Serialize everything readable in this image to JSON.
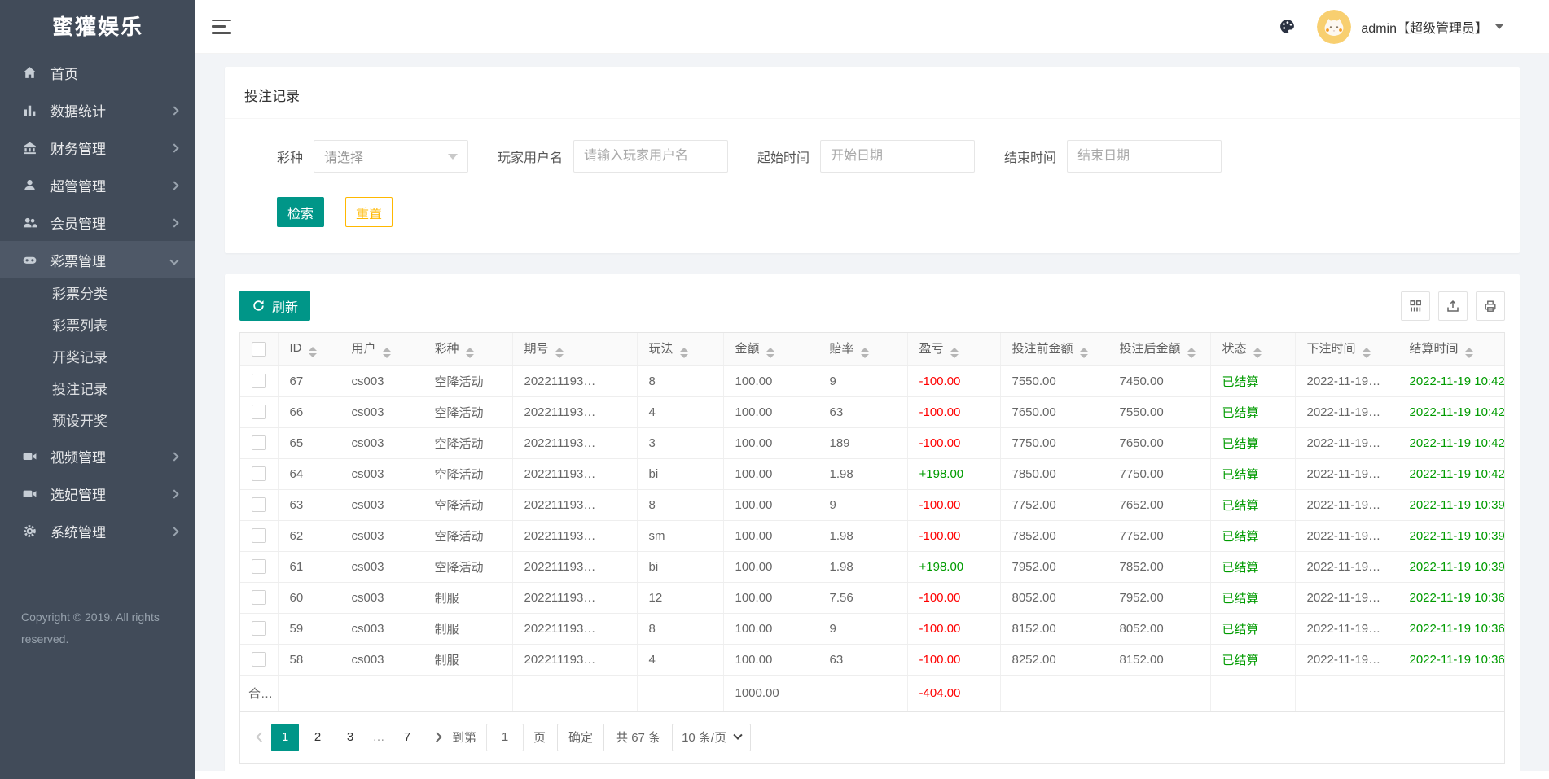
{
  "brand": {
    "logo": "蜜獾娱乐"
  },
  "colors": {
    "accent_green": "#009688",
    "warn_yellow": "#FFB800",
    "loss_red": "#ff0000",
    "win_green": "#009b00",
    "sidebar_bg": "#414b59"
  },
  "sidebar": {
    "items": [
      {
        "label": "首页",
        "icon": "home-icon"
      },
      {
        "label": "数据统计",
        "icon": "chart-icon"
      },
      {
        "label": "财务管理",
        "icon": "bank-icon"
      },
      {
        "label": "超管管理",
        "icon": "user-icon"
      },
      {
        "label": "会员管理",
        "icon": "users-icon"
      },
      {
        "label": "彩票管理",
        "icon": "gamepad-icon",
        "active": true,
        "children": [
          "彩票分类",
          "彩票列表",
          "开奖记录",
          "投注记录",
          "预设开奖"
        ]
      },
      {
        "label": "视频管理",
        "icon": "video-icon"
      },
      {
        "label": "选妃管理",
        "icon": "video-icon"
      },
      {
        "label": "系统管理",
        "icon": "gear-icon"
      }
    ],
    "copyright": "Copyright © 2019. All rights reserved."
  },
  "topbar": {
    "user": "admin【超级管理员】"
  },
  "page": {
    "title": "投注记录"
  },
  "filters": {
    "lottery_label": "彩种",
    "lottery_placeholder": "请选择",
    "username_label": "玩家用户名",
    "username_placeholder": "请输入玩家用户名",
    "start_label": "起始时间",
    "start_placeholder": "开始日期",
    "end_label": "结束时间",
    "end_placeholder": "结束日期",
    "search_button": "检索",
    "reset_button": "重置"
  },
  "table": {
    "refresh_button": "刷新",
    "columns": [
      {
        "key": "id",
        "label": "ID"
      },
      {
        "key": "user",
        "label": "用户"
      },
      {
        "key": "lottery",
        "label": "彩种"
      },
      {
        "key": "issue",
        "label": "期号"
      },
      {
        "key": "play",
        "label": "玩法"
      },
      {
        "key": "amount",
        "label": "金额"
      },
      {
        "key": "odds",
        "label": "赔率"
      },
      {
        "key": "profit",
        "label": "盈亏"
      },
      {
        "key": "before",
        "label": "投注前金额"
      },
      {
        "key": "after",
        "label": "投注后金额"
      },
      {
        "key": "status",
        "label": "状态"
      },
      {
        "key": "bet_time",
        "label": "下注时间"
      },
      {
        "key": "settle_time",
        "label": "结算时间"
      }
    ],
    "rows": [
      {
        "id": "67",
        "user": "cs003",
        "lottery": "空降活动",
        "issue": "202211193…",
        "play": "8",
        "amount": "100.00",
        "odds": "9",
        "profit": "-100.00",
        "before": "7550.00",
        "after": "7450.00",
        "status": "已结算",
        "bet_time": "2022-11-19…",
        "settle_time": "2022-11-19 10:42"
      },
      {
        "id": "66",
        "user": "cs003",
        "lottery": "空降活动",
        "issue": "202211193…",
        "play": "4",
        "amount": "100.00",
        "odds": "63",
        "profit": "-100.00",
        "before": "7650.00",
        "after": "7550.00",
        "status": "已结算",
        "bet_time": "2022-11-19…",
        "settle_time": "2022-11-19 10:42"
      },
      {
        "id": "65",
        "user": "cs003",
        "lottery": "空降活动",
        "issue": "202211193…",
        "play": "3",
        "amount": "100.00",
        "odds": "189",
        "profit": "-100.00",
        "before": "7750.00",
        "after": "7650.00",
        "status": "已结算",
        "bet_time": "2022-11-19…",
        "settle_time": "2022-11-19 10:42"
      },
      {
        "id": "64",
        "user": "cs003",
        "lottery": "空降活动",
        "issue": "202211193…",
        "play": "bi",
        "amount": "100.00",
        "odds": "1.98",
        "profit": "+198.00",
        "before": "7850.00",
        "after": "7750.00",
        "status": "已结算",
        "bet_time": "2022-11-19…",
        "settle_time": "2022-11-19 10:42"
      },
      {
        "id": "63",
        "user": "cs003",
        "lottery": "空降活动",
        "issue": "202211193…",
        "play": "8",
        "amount": "100.00",
        "odds": "9",
        "profit": "-100.00",
        "before": "7752.00",
        "after": "7652.00",
        "status": "已结算",
        "bet_time": "2022-11-19…",
        "settle_time": "2022-11-19 10:39"
      },
      {
        "id": "62",
        "user": "cs003",
        "lottery": "空降活动",
        "issue": "202211193…",
        "play": "sm",
        "amount": "100.00",
        "odds": "1.98",
        "profit": "-100.00",
        "before": "7852.00",
        "after": "7752.00",
        "status": "已结算",
        "bet_time": "2022-11-19…",
        "settle_time": "2022-11-19 10:39"
      },
      {
        "id": "61",
        "user": "cs003",
        "lottery": "空降活动",
        "issue": "202211193…",
        "play": "bi",
        "amount": "100.00",
        "odds": "1.98",
        "profit": "+198.00",
        "before": "7952.00",
        "after": "7852.00",
        "status": "已结算",
        "bet_time": "2022-11-19…",
        "settle_time": "2022-11-19 10:39"
      },
      {
        "id": "60",
        "user": "cs003",
        "lottery": "制服",
        "issue": "202211193…",
        "play": "12",
        "amount": "100.00",
        "odds": "7.56",
        "profit": "-100.00",
        "before": "8052.00",
        "after": "7952.00",
        "status": "已结算",
        "bet_time": "2022-11-19…",
        "settle_time": "2022-11-19 10:36"
      },
      {
        "id": "59",
        "user": "cs003",
        "lottery": "制服",
        "issue": "202211193…",
        "play": "8",
        "amount": "100.00",
        "odds": "9",
        "profit": "-100.00",
        "before": "8152.00",
        "after": "8052.00",
        "status": "已结算",
        "bet_time": "2022-11-19…",
        "settle_time": "2022-11-19 10:36"
      },
      {
        "id": "58",
        "user": "cs003",
        "lottery": "制服",
        "issue": "202211193…",
        "play": "4",
        "amount": "100.00",
        "odds": "63",
        "profit": "-100.00",
        "before": "8252.00",
        "after": "8152.00",
        "status": "已结算",
        "bet_time": "2022-11-19…",
        "settle_time": "2022-11-19 10:36"
      }
    ],
    "sum_row": {
      "label": "合…",
      "amount": "1000.00",
      "profit": "-404.00"
    }
  },
  "pagination": {
    "pages": [
      "1",
      "2",
      "3",
      "…",
      "7"
    ],
    "active": "1",
    "goto_label": "到第",
    "goto_value": "1",
    "page_label": "页",
    "confirm_button": "确定",
    "total": "共 67 条",
    "page_size": "10 条/页"
  }
}
